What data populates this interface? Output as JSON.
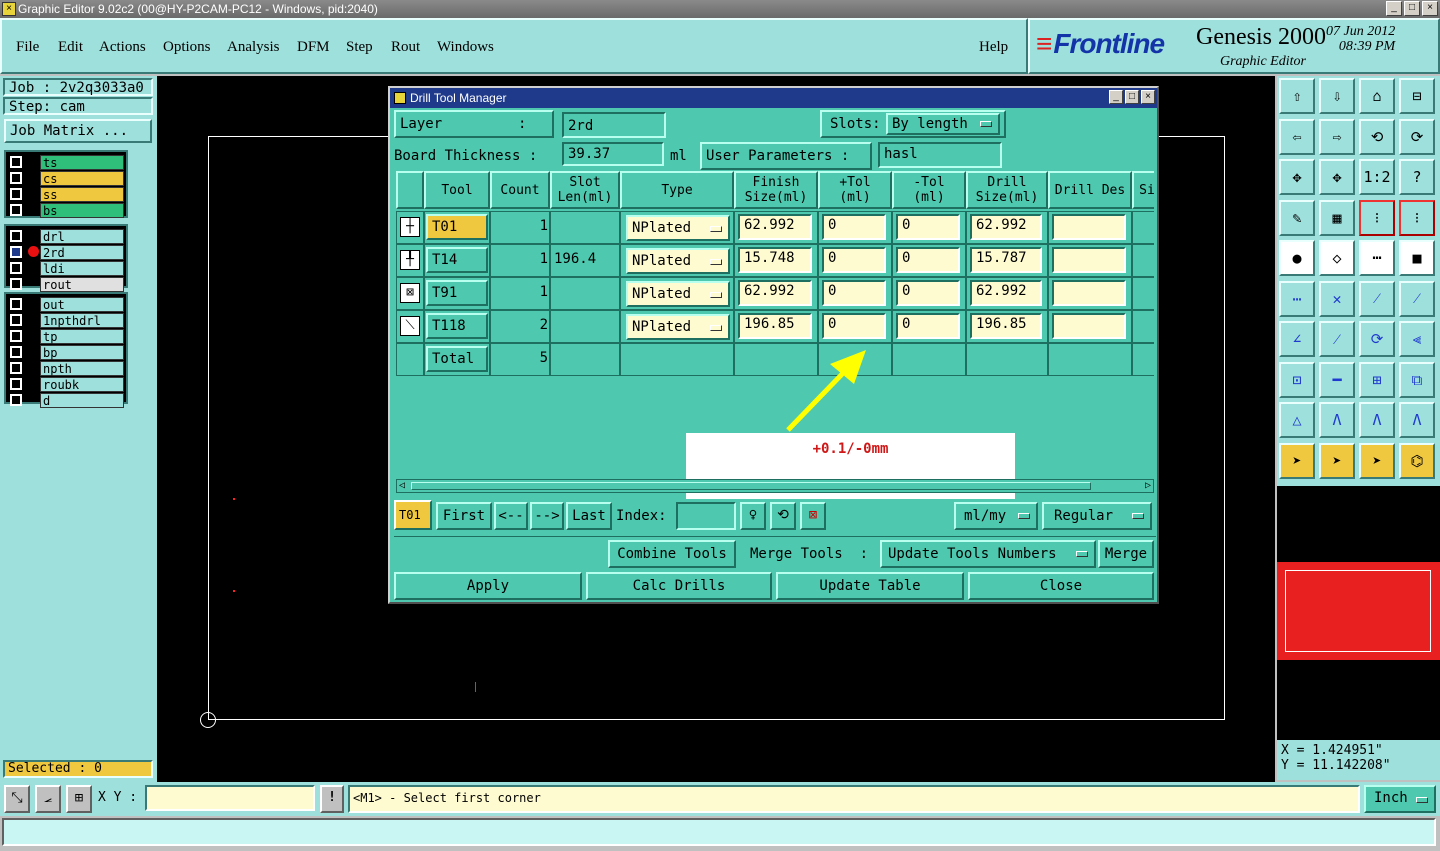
{
  "window": {
    "title": "Graphic Editor 9.02c2 (00@HY-P2CAM-PC12 - Windows, pid:2040)"
  },
  "menu": [
    "File",
    "Edit",
    "Actions",
    "Options",
    "Analysis",
    "DFM",
    "Step",
    "Rout",
    "Windows"
  ],
  "help": "Help",
  "brand": {
    "logo": "Frontline",
    "product": "Genesis 2000",
    "subtitle": "Graphic Editor",
    "date": "07 Jun 2012",
    "time": "08:39 PM"
  },
  "job": {
    "job": "Job : 2v2q3033a0",
    "step": "Step: cam",
    "matrix": "Job Matrix ..."
  },
  "layers": {
    "group1": [
      {
        "name": "ts",
        "color": "#2fbf7a"
      },
      {
        "name": "cs",
        "color": "#f0c840"
      },
      {
        "name": "ss",
        "color": "#f0c840"
      },
      {
        "name": "bs",
        "color": "#2fbf7a"
      }
    ],
    "group2": [
      {
        "name": "drl",
        "color": "#9ee0dc"
      },
      {
        "name": "2rd",
        "color": "#9ee0dc"
      },
      {
        "name": "ldi",
        "color": "#9ee0dc"
      },
      {
        "name": "rout",
        "color": "#e0e0e0"
      }
    ],
    "group3": [
      {
        "name": "out"
      },
      {
        "name": "1npthdrl"
      },
      {
        "name": "tp"
      },
      {
        "name": "bp"
      },
      {
        "name": "npth"
      },
      {
        "name": "roubk"
      },
      {
        "name": "d"
      }
    ]
  },
  "selected": "Selected : 0",
  "coords": {
    "x": "X = 1.424951\"",
    "y": "Y = 11.142208\""
  },
  "cmd": {
    "xy_label": "X Y :",
    "xy_value": "",
    "prompt": "<M1> - Select first corner",
    "units": "Inch"
  },
  "dialog": {
    "title": "Drill Tool Manager",
    "layer_label": "Layer         :",
    "layer_value": "2rd",
    "slots_label": "Slots:",
    "slots_value": "By length",
    "board_thickness_label": "Board Thickness :",
    "board_thickness_value": "39.37",
    "board_thickness_unit": "ml",
    "user_params_label": "User Parameters :",
    "user_params_value": "hasl",
    "headers": [
      "Tool",
      "Count",
      "Slot Len(ml)",
      "Type",
      "Finish Size(ml)",
      "+Tol (ml)",
      "-Tol (ml)",
      "Drill Size(ml)",
      "Drill Des",
      "Si"
    ],
    "rows": [
      {
        "tool": "T01",
        "count": "1",
        "slot_len": "",
        "type": "NPlated",
        "finish": "62.992",
        "ptol": "0",
        "mtol": "0",
        "drill": "62.992",
        "des": ""
      },
      {
        "tool": "T14",
        "count": "1",
        "slot_len": "196.4",
        "type": "NPlated",
        "finish": "15.748",
        "ptol": "0",
        "mtol": "0",
        "drill": "15.787",
        "des": ""
      },
      {
        "tool": "T91",
        "count": "1",
        "slot_len": "",
        "type": "NPlated",
        "finish": "62.992",
        "ptol": "0",
        "mtol": "0",
        "drill": "62.992",
        "des": ""
      },
      {
        "tool": "T118",
        "count": "2",
        "slot_len": "",
        "type": "NPlated",
        "finish": "196.85",
        "ptol": "0",
        "mtol": "0",
        "drill": "196.85",
        "des": ""
      }
    ],
    "total_label": "Total",
    "total_count": "5",
    "annotation": "+0.1/-0mm",
    "nav": {
      "current": "T01",
      "first": "First",
      "prev": "<--",
      "next": "-->",
      "last": "Last",
      "index_label": "Index:",
      "index_value": "",
      "units": "ml/my",
      "mode": "Regular"
    },
    "combine": "Combine Tools",
    "merge_label": "Merge Tools  :",
    "merge_option": "Update Tools Numbers",
    "merge": "Merge",
    "apply": "Apply",
    "calc": "Calc Drills",
    "update": "Update Table",
    "close": "Close"
  }
}
